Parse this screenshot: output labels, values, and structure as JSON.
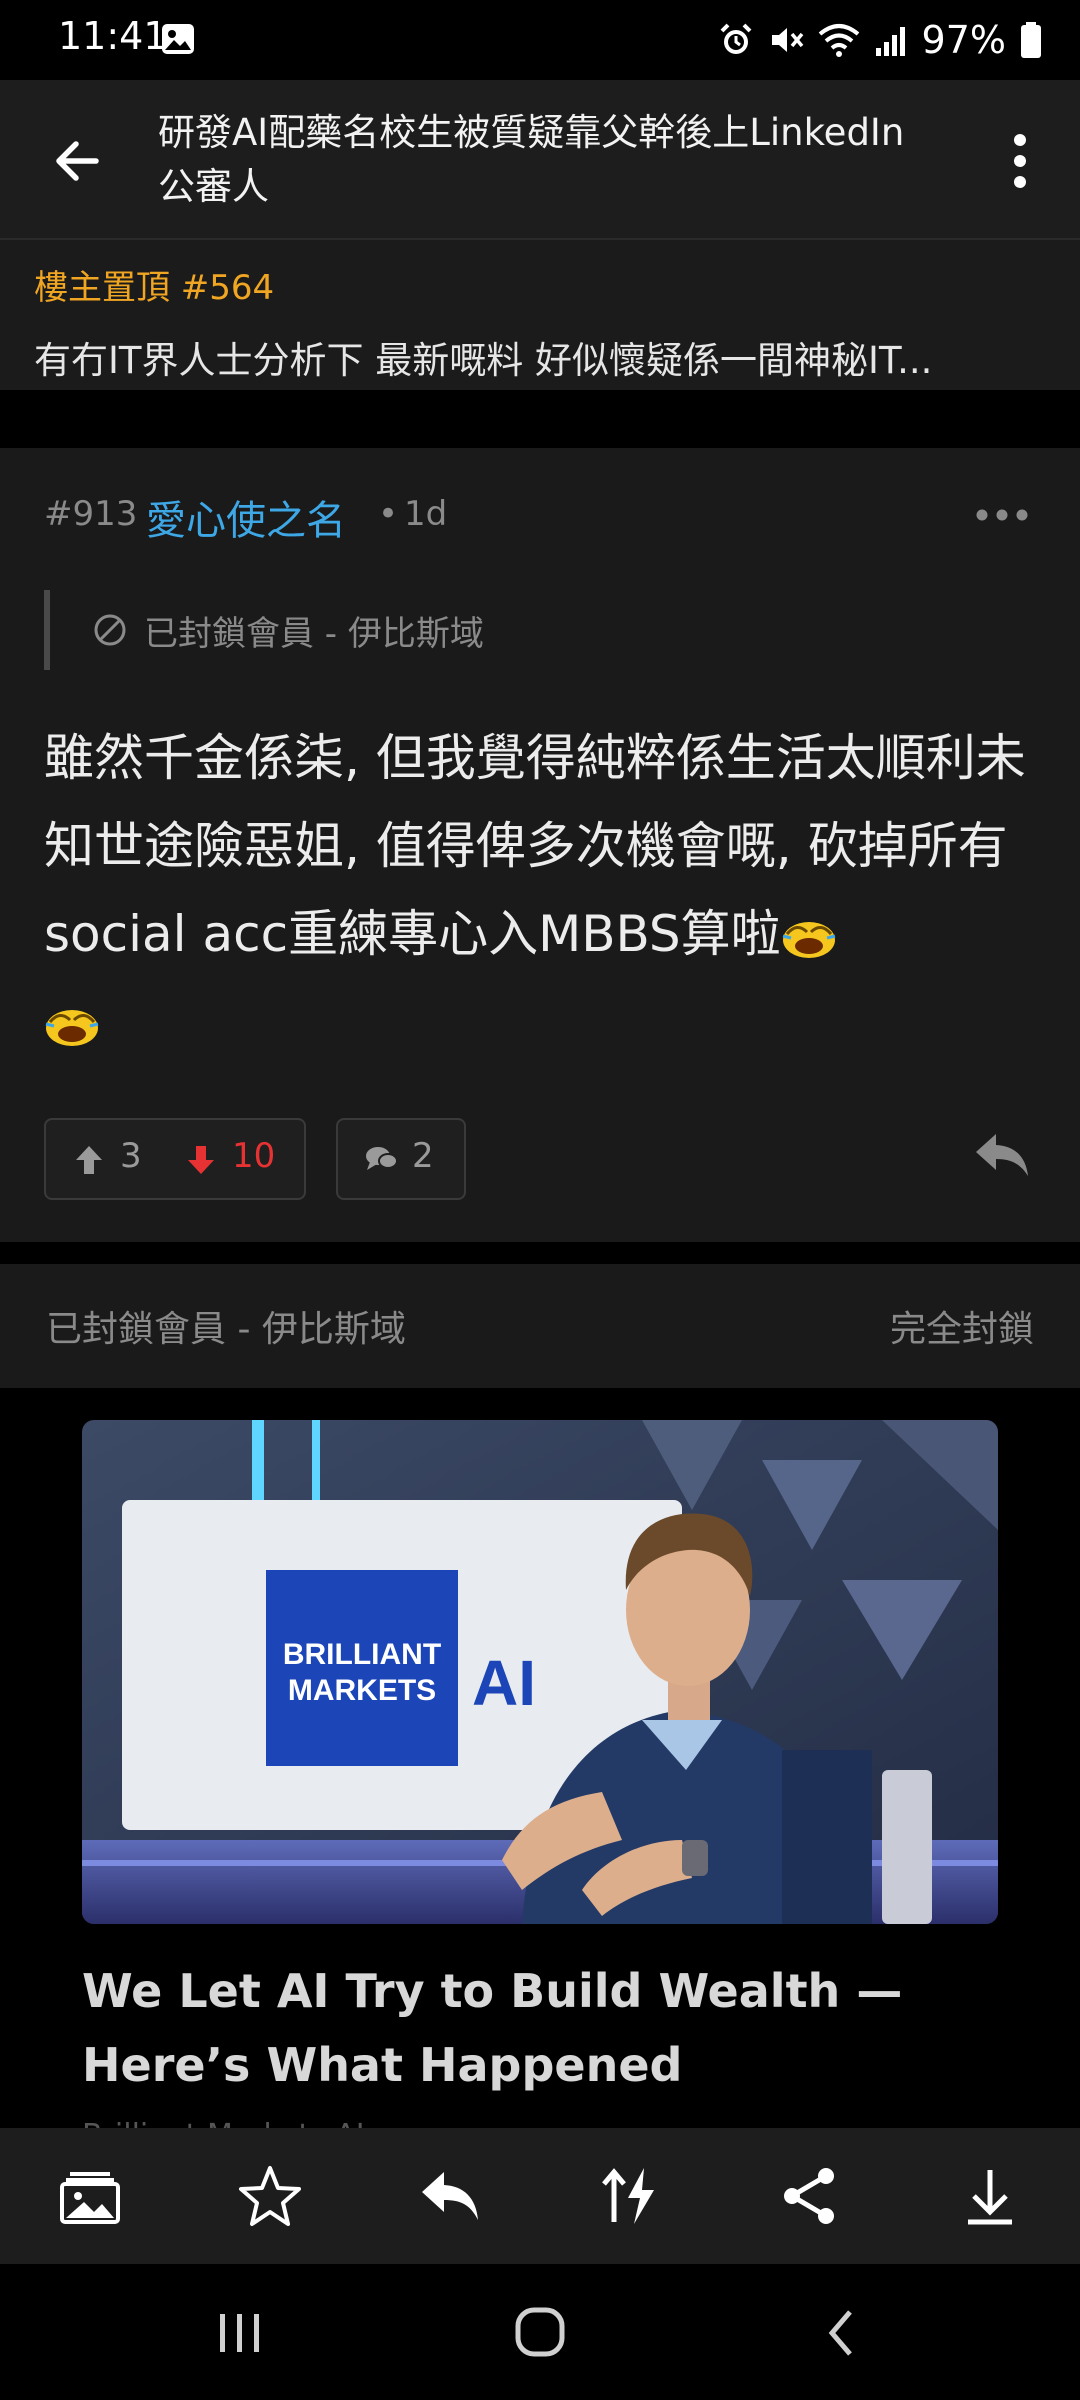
{
  "status_bar": {
    "time": "11:41",
    "battery": "97%"
  },
  "header": {
    "title": "研發AI配藥名校生被質疑靠父幹後上LinkedIn公審人"
  },
  "pinned": {
    "label": "樓主置頂 #564",
    "text": "有冇IT界人士分析下 最新嘅料 好似懷疑係一間神秘IT..."
  },
  "post": {
    "floor": "#913",
    "author": "愛心使之名",
    "dot": "•",
    "time": "1d",
    "quote": "已封鎖會員 - 伊比斯域",
    "body": "雖然千金係柒, 但我覺得純粹係生活太順利未知世途險惡姐, 值得俾多次機會嘅, 砍掉所有social acc重練專心入MBBS算啦",
    "upvotes": "3",
    "downvotes": "10",
    "replies": "2"
  },
  "blocked": {
    "name": "已封鎖會員 - 伊比斯域",
    "action": "完全封鎖"
  },
  "ad": {
    "screen_text_1": "BRILLIANT",
    "screen_text_2": "MARKETS",
    "screen_text_3": "AI",
    "title": "We Let AI Try to Build Wealth — Here’s What Happened",
    "source": "Brilliant Markets AI"
  },
  "icons": {
    "status": [
      "image-icon",
      "alarm-icon",
      "mute-icon",
      "wifi-icon",
      "signal-icon",
      "battery-icon"
    ],
    "toolbar": [
      "gallery-icon",
      "star-icon",
      "reply-icon",
      "sort-icon",
      "share-icon",
      "download-icon"
    ],
    "nav": [
      "recents-icon",
      "home-icon",
      "back-icon"
    ]
  },
  "colors": {
    "accent_author": "#3ea7e6",
    "pinned_label": "#f0a623",
    "downvote": "#e63232"
  }
}
